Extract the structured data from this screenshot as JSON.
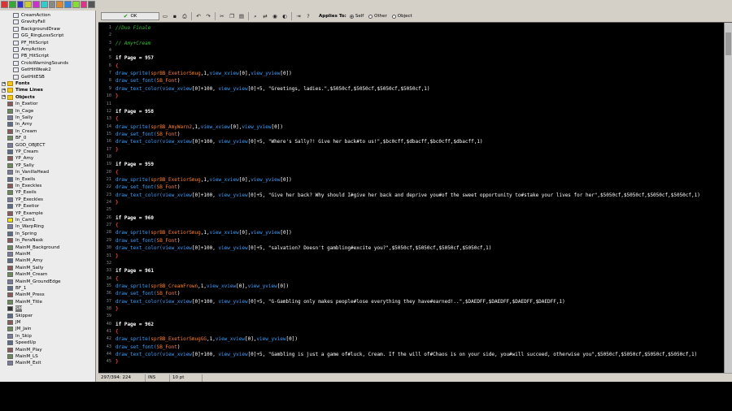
{
  "tree": {
    "items": [
      {
        "label": "CreamAction",
        "kind": "script",
        "depth": 2
      },
      {
        "label": "GravityFall",
        "kind": "script",
        "depth": 2
      },
      {
        "label": "BackgroundDraw",
        "kind": "script",
        "depth": 2
      },
      {
        "label": "GG_RingLossScript",
        "kind": "script",
        "depth": 2
      },
      {
        "label": "PF_HitScript",
        "kind": "script",
        "depth": 2
      },
      {
        "label": "AmyAction",
        "kind": "script",
        "depth": 2
      },
      {
        "label": "PB_HitScript",
        "kind": "script",
        "depth": 2
      },
      {
        "label": "CroloWarningSounds",
        "kind": "script",
        "depth": 2
      },
      {
        "label": "GetHitWeak2",
        "kind": "script",
        "depth": 2
      },
      {
        "label": "GetHitESB",
        "kind": "script",
        "depth": 2
      },
      {
        "label": "Fonts",
        "kind": "folder",
        "depth": 0
      },
      {
        "label": "Time Lines",
        "kind": "folder",
        "depth": 0
      },
      {
        "label": "Objects",
        "kind": "folder",
        "depth": 0
      },
      {
        "label": "In_Exetior",
        "kind": "object",
        "depth": 1
      },
      {
        "label": "In_Cage",
        "kind": "object",
        "depth": 1
      },
      {
        "label": "In_Sally",
        "kind": "object",
        "depth": 1
      },
      {
        "label": "In_Amy",
        "kind": "object",
        "depth": 1
      },
      {
        "label": "In_Cream",
        "kind": "object",
        "depth": 1
      },
      {
        "label": "BF_0",
        "kind": "object",
        "depth": 1
      },
      {
        "label": "GOD_OBJECT",
        "kind": "object",
        "depth": 1
      },
      {
        "label": "YP_Cream",
        "kind": "object",
        "depth": 1
      },
      {
        "label": "YP_Amy",
        "kind": "object",
        "depth": 1
      },
      {
        "label": "YP_Sally",
        "kind": "object",
        "depth": 1
      },
      {
        "label": "In_VanillaHead",
        "kind": "object",
        "depth": 1
      },
      {
        "label": "In_Exeils",
        "kind": "object",
        "depth": 1
      },
      {
        "label": "In_Execkles",
        "kind": "object",
        "depth": 1
      },
      {
        "label": "YP_Exeils",
        "kind": "object",
        "depth": 1
      },
      {
        "label": "YP_Execkles",
        "kind": "object",
        "depth": 1
      },
      {
        "label": "YP_Exetior",
        "kind": "object",
        "depth": 1
      },
      {
        "label": "YP_Example",
        "kind": "object",
        "depth": 1
      },
      {
        "label": "In_Cam1",
        "kind": "object-yellow",
        "depth": 1
      },
      {
        "label": "In_WarpRing",
        "kind": "object",
        "depth": 1
      },
      {
        "label": "In_Spring",
        "kind": "object",
        "depth": 1
      },
      {
        "label": "In_PeraNask",
        "kind": "object",
        "depth": 1
      },
      {
        "label": "MainM_Background",
        "kind": "object",
        "depth": 1
      },
      {
        "label": "MainM",
        "kind": "object",
        "depth": 1
      },
      {
        "label": "MainM_Amy",
        "kind": "object",
        "depth": 1
      },
      {
        "label": "MainM_Sally",
        "kind": "object",
        "depth": 1
      },
      {
        "label": "MainM_Cream",
        "kind": "object",
        "depth": 1
      },
      {
        "label": "MainM_GroundEdge",
        "kind": "object",
        "depth": 1
      },
      {
        "label": "BF_1",
        "kind": "object",
        "depth": 1
      },
      {
        "label": "MainM_Press",
        "kind": "object",
        "depth": 1
      },
      {
        "label": "MainM_Title",
        "kind": "object",
        "depth": 1
      },
      {
        "label": "SM",
        "kind": "object-selected",
        "depth": 1
      },
      {
        "label": "Skipper",
        "kind": "object",
        "depth": 1
      },
      {
        "label": "JM",
        "kind": "object",
        "depth": 1
      },
      {
        "label": "JM_Jain",
        "kind": "object",
        "depth": 1
      },
      {
        "label": "In_Skip",
        "kind": "object",
        "depth": 1
      },
      {
        "label": "SpeedUp",
        "kind": "object",
        "depth": 1
      },
      {
        "label": "MainM_Play",
        "kind": "object",
        "depth": 1
      },
      {
        "label": "MainM_LS",
        "kind": "object",
        "depth": 1
      },
      {
        "label": "MainM_Exit",
        "kind": "object",
        "depth": 1
      }
    ]
  },
  "editor": {
    "ok_label": "OK",
    "applies_to_label": "Applies To:",
    "applies_options": [
      "Self",
      "Other",
      "Object"
    ],
    "applies_selected": "Self",
    "status": {
      "position": "297/394: 224",
      "mode": "INS",
      "font_size": "10 pt"
    },
    "lines": [
      {
        "n": "1",
        "segs": [
          [
            "c",
            "//Duo Finale"
          ]
        ]
      },
      {
        "n": "2",
        "segs": []
      },
      {
        "n": "3",
        "segs": [
          [
            "c",
            "// Amy+Cream"
          ]
        ]
      },
      {
        "n": "4",
        "segs": []
      },
      {
        "n": "5",
        "segs": [
          [
            "k",
            "if Page = "
          ],
          [
            "k",
            "957"
          ]
        ]
      },
      {
        "n": "6",
        "segs": [
          [
            "b",
            "{"
          ]
        ]
      },
      {
        "n": "7",
        "segs": [
          [
            "f",
            "draw_sprite("
          ],
          [
            "r",
            "sprBB_ExetiorSmug"
          ],
          [
            "t",
            ",1,"
          ],
          [
            "f",
            "view_xview"
          ],
          [
            "t",
            "[0],"
          ],
          [
            "f",
            "view_yview"
          ],
          [
            "t",
            "[0])"
          ]
        ]
      },
      {
        "n": "8",
        "segs": [
          [
            "f",
            "draw_set_font("
          ],
          [
            "r",
            "SB_Font"
          ],
          [
            "t",
            ")"
          ]
        ]
      },
      {
        "n": "9",
        "segs": [
          [
            "f",
            "draw_text_color("
          ],
          [
            "f",
            "view_xview"
          ],
          [
            "t",
            "[0]+100, "
          ],
          [
            "f",
            "view_yview"
          ],
          [
            "t",
            "[0]+5, \"Greetings, ladies.\",$5050cf,$5050cf,$5050cf,$5050cf,1)"
          ]
        ]
      },
      {
        "n": "10",
        "segs": [
          [
            "b",
            "}"
          ]
        ]
      },
      {
        "n": "11",
        "segs": []
      },
      {
        "n": "12",
        "segs": [
          [
            "k",
            "if Page = "
          ],
          [
            "k",
            "958"
          ]
        ]
      },
      {
        "n": "13",
        "segs": [
          [
            "b",
            "{"
          ]
        ]
      },
      {
        "n": "14",
        "segs": [
          [
            "f",
            "draw_sprite("
          ],
          [
            "r",
            "sprBB_AmyWarn2"
          ],
          [
            "t",
            ",1,"
          ],
          [
            "f",
            "view_xview"
          ],
          [
            "t",
            "[0],"
          ],
          [
            "f",
            "view_yview"
          ],
          [
            "t",
            "[0])"
          ]
        ]
      },
      {
        "n": "15",
        "segs": [
          [
            "f",
            "draw_set_font("
          ],
          [
            "r",
            "SB_Font"
          ],
          [
            "t",
            ")"
          ]
        ]
      },
      {
        "n": "16",
        "segs": [
          [
            "f",
            "draw_text_color("
          ],
          [
            "f",
            "view_xview"
          ],
          [
            "t",
            "[0]+100, "
          ],
          [
            "f",
            "view_yview"
          ],
          [
            "t",
            "[0]+5, \"Where's Sally?! Give her back#to us!\",$bc0cff,$dbacff,$bc0cff,$dbacff,1)"
          ]
        ]
      },
      {
        "n": "17",
        "segs": [
          [
            "b",
            "}"
          ]
        ]
      },
      {
        "n": "18",
        "segs": []
      },
      {
        "n": "19",
        "segs": [
          [
            "k",
            "if Page = "
          ],
          [
            "k",
            "959"
          ]
        ]
      },
      {
        "n": "20",
        "segs": [
          [
            "b",
            "{"
          ]
        ]
      },
      {
        "n": "21",
        "segs": [
          [
            "f",
            "draw_sprite("
          ],
          [
            "r",
            "sprBB_ExetiorSmug"
          ],
          [
            "t",
            ",1,"
          ],
          [
            "f",
            "view_xview"
          ],
          [
            "t",
            "[0],"
          ],
          [
            "f",
            "view_yview"
          ],
          [
            "t",
            "[0])"
          ]
        ]
      },
      {
        "n": "22",
        "segs": [
          [
            "f",
            "draw_set_font("
          ],
          [
            "r",
            "SB_Font"
          ],
          [
            "t",
            ")"
          ]
        ]
      },
      {
        "n": "23",
        "segs": [
          [
            "f",
            "draw_text_color("
          ],
          [
            "f",
            "view_xview"
          ],
          [
            "t",
            "[0]+100, "
          ],
          [
            "f",
            "view_yview"
          ],
          [
            "t",
            "[0]+5, \"Give her back? Why should I#give her back and deprive you#of the sweet opportunity to#stake your lives for her\",$5050cf,$5050cf,$5050cf,$5050cf,1)"
          ]
        ]
      },
      {
        "n": "24",
        "segs": [
          [
            "b",
            "}"
          ]
        ]
      },
      {
        "n": "25",
        "segs": []
      },
      {
        "n": "26",
        "segs": [
          [
            "k",
            "if Page = "
          ],
          [
            "k",
            "960"
          ]
        ]
      },
      {
        "n": "27",
        "segs": [
          [
            "b",
            "{"
          ]
        ]
      },
      {
        "n": "28",
        "segs": [
          [
            "f",
            "draw_sprite("
          ],
          [
            "r",
            "sprBB_ExetiorSmug"
          ],
          [
            "t",
            ",1,"
          ],
          [
            "f",
            "view_xview"
          ],
          [
            "t",
            "[0],"
          ],
          [
            "f",
            "view_yview"
          ],
          [
            "t",
            "[0])"
          ]
        ]
      },
      {
        "n": "29",
        "segs": [
          [
            "f",
            "draw_set_font("
          ],
          [
            "r",
            "SB_Font"
          ],
          [
            "t",
            ")"
          ]
        ]
      },
      {
        "n": "30",
        "segs": [
          [
            "f",
            "draw_text_color("
          ],
          [
            "f",
            "view_xview"
          ],
          [
            "t",
            "[0]+100, "
          ],
          [
            "f",
            "view_yview"
          ],
          [
            "t",
            "[0]+5, \"salvation? Doesn't gambling#excite you?\",$5050cf,$5050cf,$5050cf,$5050cf,1)"
          ]
        ]
      },
      {
        "n": "31",
        "segs": [
          [
            "b",
            "}"
          ]
        ]
      },
      {
        "n": "32",
        "segs": []
      },
      {
        "n": "33",
        "segs": [
          [
            "k",
            "if Page = "
          ],
          [
            "k",
            "961"
          ]
        ]
      },
      {
        "n": "34",
        "segs": [
          [
            "b",
            "{"
          ]
        ]
      },
      {
        "n": "35",
        "segs": [
          [
            "f",
            "draw_sprite("
          ],
          [
            "r",
            "sprBB_CreamFrown"
          ],
          [
            "t",
            ",1,"
          ],
          [
            "f",
            "view_xview"
          ],
          [
            "t",
            "[0],"
          ],
          [
            "f",
            "view_yview"
          ],
          [
            "t",
            "[0])"
          ]
        ]
      },
      {
        "n": "36",
        "segs": [
          [
            "f",
            "draw_set_font("
          ],
          [
            "r",
            "SB_Font"
          ],
          [
            "t",
            ")"
          ]
        ]
      },
      {
        "n": "37",
        "segs": [
          [
            "f",
            "draw_text_color("
          ],
          [
            "f",
            "view_xview"
          ],
          [
            "t",
            "[0]+100, "
          ],
          [
            "f",
            "view_yview"
          ],
          [
            "t",
            "[0]+5, \"G-Gambling only makes people#lose everything they have#earned!..\",$DAEDFF,$DAEDFF,$DAEDFF,$DAEDFF,1)"
          ]
        ]
      },
      {
        "n": "38",
        "segs": [
          [
            "b",
            "}"
          ]
        ]
      },
      {
        "n": "39",
        "segs": []
      },
      {
        "n": "40",
        "segs": [
          [
            "k",
            "if Page = "
          ],
          [
            "k",
            "962"
          ]
        ]
      },
      {
        "n": "41",
        "segs": [
          [
            "b",
            "{"
          ]
        ]
      },
      {
        "n": "42",
        "segs": [
          [
            "f",
            "draw_sprite("
          ],
          [
            "r",
            "sprBB_ExetiorSmugGG"
          ],
          [
            "t",
            ",1,"
          ],
          [
            "f",
            "view_xview"
          ],
          [
            "t",
            "[0],"
          ],
          [
            "f",
            "view_yview"
          ],
          [
            "t",
            "[0])"
          ]
        ]
      },
      {
        "n": "43",
        "segs": [
          [
            "f",
            "draw_set_font("
          ],
          [
            "r",
            "SB_Font"
          ],
          [
            "t",
            ")"
          ]
        ]
      },
      {
        "n": "44",
        "segs": [
          [
            "f",
            "draw_text_color("
          ],
          [
            "f",
            "view_xview"
          ],
          [
            "t",
            "[0]+100, "
          ],
          [
            "f",
            "view_yview"
          ],
          [
            "t",
            "[0]+5, \"Gambling is just a game of#luck, Cream. If the will of#Chaos is on your side, you#will succeed, otherwise you\",$5050cf,$5050cf,$5050cf,$5050cf,1)"
          ]
        ]
      },
      {
        "n": "45",
        "segs": [
          [
            "b",
            "}"
          ]
        ]
      }
    ]
  },
  "colors": {
    "comment": "#2cbf2c",
    "function": "#3aa0ff",
    "resource": "#ff7f2a",
    "brace": "#ff4040",
    "text": "#f0f0f0"
  }
}
